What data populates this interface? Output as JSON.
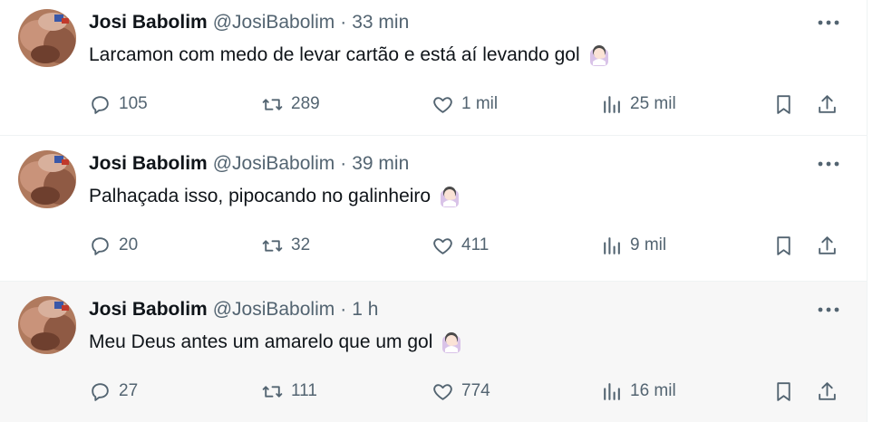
{
  "tweets": [
    {
      "name": "Josi Babolim",
      "handle": "@JosiBabolim",
      "time": "33 min",
      "text": "Larcamon com medo de levar cartão e está aí levando gol",
      "emoji": "face-palm-emoji",
      "replies": "105",
      "retweets": "289",
      "likes": "1 mil",
      "views": "25 mil"
    },
    {
      "name": "Josi Babolim",
      "handle": "@JosiBabolim",
      "time": "39 min",
      "text": "Palhaçada isso, pipocando no galinheiro",
      "emoji": "face-palm-emoji",
      "replies": "20",
      "retweets": "32",
      "likes": "411",
      "views": "9 mil"
    },
    {
      "name": "Josi Babolim",
      "handle": "@JosiBabolim",
      "time": "1 h",
      "text": "Meu Deus antes um amarelo que um gol",
      "emoji": "face-palm-emoji",
      "replies": "27",
      "retweets": "111",
      "likes": "774",
      "views": "16 mil"
    }
  ],
  "separator": "·",
  "colors": {
    "text": "#0f1419",
    "secondary": "#536471",
    "divider": "#eff3f4",
    "hover_bg": "#f7f7f7"
  },
  "icons": [
    "reply-icon",
    "retweet-icon",
    "like-icon",
    "views-icon",
    "bookmark-icon",
    "share-icon",
    "more-icon"
  ]
}
